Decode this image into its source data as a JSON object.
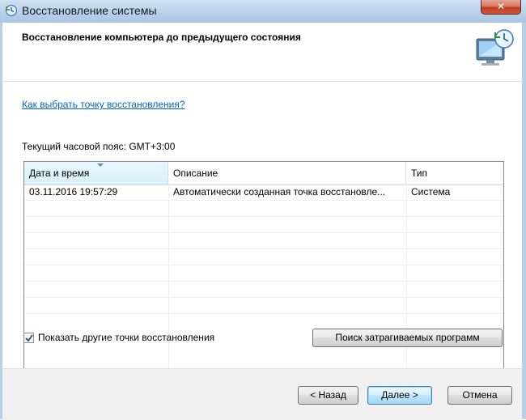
{
  "window": {
    "title": "Восстановление системы",
    "close_label": "✕"
  },
  "header": {
    "title": "Восстановление компьютера до предыдущего состояния"
  },
  "content": {
    "help_link": "Как выбрать точку восстановления?",
    "timezone": "Текущий часовой пояс: GMT+3:00",
    "table": {
      "columns": [
        "Дата и время",
        "Описание",
        "Тип"
      ],
      "rows": [
        [
          "03.11.2016 19:57:29",
          "Автоматически созданная точка восстановле...",
          "Система"
        ]
      ]
    },
    "show_more": {
      "label": "Показать другие точки восстановления",
      "checked": true
    },
    "scan_button": "Поиск затрагиваемых программ"
  },
  "footer": {
    "back": "< Назад",
    "next": "Далее >",
    "cancel": "Отмена"
  }
}
